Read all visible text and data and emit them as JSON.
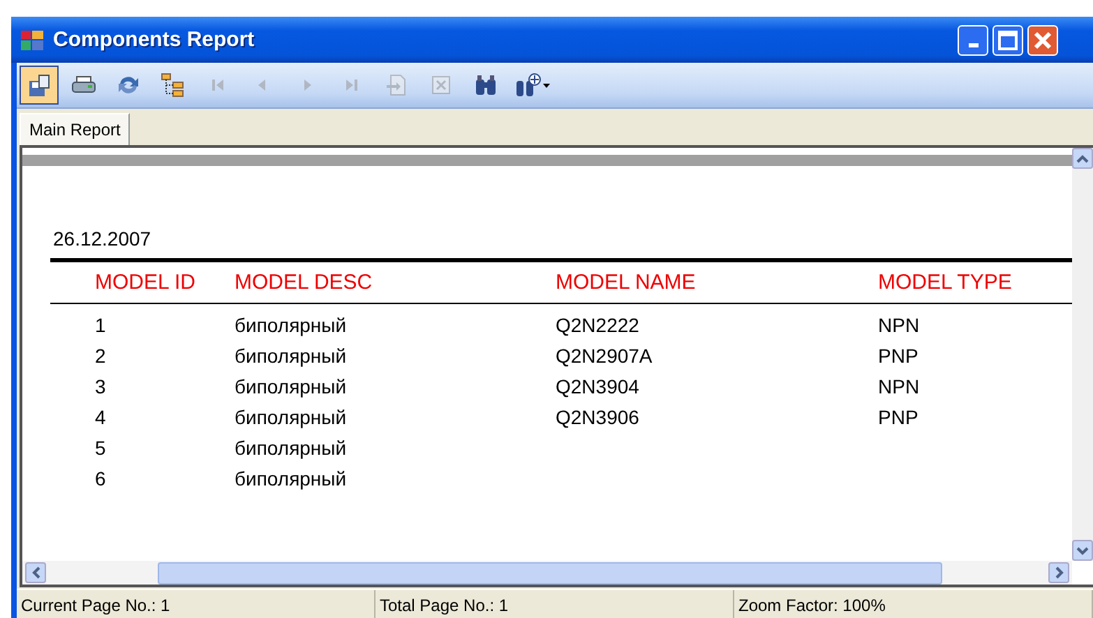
{
  "window": {
    "title": "Components Report"
  },
  "toolbar": [
    {
      "kind": "export",
      "disabled": false,
      "selected": true
    },
    {
      "kind": "print",
      "disabled": false,
      "selected": false
    },
    {
      "kind": "refresh",
      "disabled": false,
      "selected": false
    },
    {
      "kind": "tree",
      "disabled": false,
      "selected": false
    },
    {
      "kind": "first",
      "disabled": true,
      "selected": false
    },
    {
      "kind": "prev",
      "disabled": true,
      "selected": false
    },
    {
      "kind": "next",
      "disabled": true,
      "selected": false
    },
    {
      "kind": "last",
      "disabled": true,
      "selected": false
    },
    {
      "kind": "goto",
      "disabled": true,
      "selected": false
    },
    {
      "kind": "stop",
      "disabled": true,
      "selected": false
    },
    {
      "kind": "search",
      "disabled": false,
      "selected": false
    },
    {
      "kind": "zoom",
      "disabled": false,
      "selected": false
    }
  ],
  "tabs": [
    {
      "label": "Main Report",
      "selected": true
    }
  ],
  "report": {
    "date": "26.12.2007",
    "columns": [
      "MODEL ID",
      "MODEL DESC",
      "MODEL NAME",
      "MODEL TYPE"
    ],
    "rows": [
      [
        "1",
        "биполярный",
        "Q2N2222",
        "NPN"
      ],
      [
        "2",
        "биполярный",
        "Q2N2907A",
        "PNP"
      ],
      [
        "3",
        "биполярный",
        "Q2N3904",
        "NPN"
      ],
      [
        "4",
        "биполярный",
        "Q2N3906",
        "PNP"
      ],
      [
        "5",
        "биполярный",
        "",
        ""
      ],
      [
        "6",
        "биполярный",
        "",
        ""
      ]
    ]
  },
  "status_bar": [
    "Current Page No.: 1",
    "Total Page No.: 1",
    "Zoom Factor: 100%"
  ]
}
